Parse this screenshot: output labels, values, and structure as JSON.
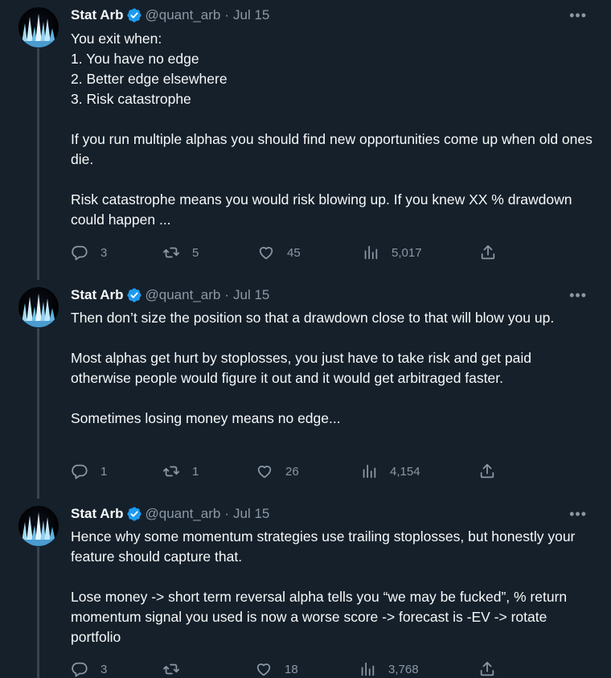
{
  "colors": {
    "background": "#15202b",
    "text": "#f7f9f9",
    "muted": "#8b98a5",
    "verified": "#1d9bf0",
    "thread_line": "#38444d"
  },
  "tweets": [
    {
      "name": "Stat Arb",
      "handle": "@quant_arb",
      "date": "Jul 15",
      "more": "•••",
      "text": "You exit when:\n1. You have no edge\n2. Better edge elsewhere\n3. Risk catastrophe\n\nIf you run multiple alphas you should find new opportunities come up when old ones die.\n\nRisk catastrophe means you would risk blowing up. If you knew XX % drawdown could happen ...",
      "replies": "3",
      "reposts": "5",
      "likes": "45",
      "views": "5,017"
    },
    {
      "name": "Stat Arb",
      "handle": "@quant_arb",
      "date": "Jul 15",
      "more": "•••",
      "text": "Then don’t size the position so that a drawdown close to that will blow you up.\n\nMost alphas get hurt by stoplosses, you just have to take risk and get paid otherwise people would figure it out and it would get arbitraged faster.\n\nSometimes losing money means no edge...",
      "replies": "1",
      "reposts": "1",
      "likes": "26",
      "views": "4,154"
    },
    {
      "name": "Stat Arb",
      "handle": "@quant_arb",
      "date": "Jul 15",
      "more": "•••",
      "text": "Hence why some momentum strategies use trailing stoplosses, but honestly your feature should capture that.\n\nLose money -> short term reversal alpha tells you “we may be fucked”, % return momentum signal you used is now a worse score -> forecast is -EV -> rotate portfolio",
      "replies": "3",
      "reposts": "",
      "likes": "18",
      "views": "3,768"
    }
  ],
  "icons": {
    "verified": "verified-badge-icon",
    "reply": "reply-icon",
    "repost": "repost-icon",
    "like": "heart-icon",
    "views": "views-chart-icon",
    "share": "share-icon",
    "more": "more-options-icon"
  }
}
